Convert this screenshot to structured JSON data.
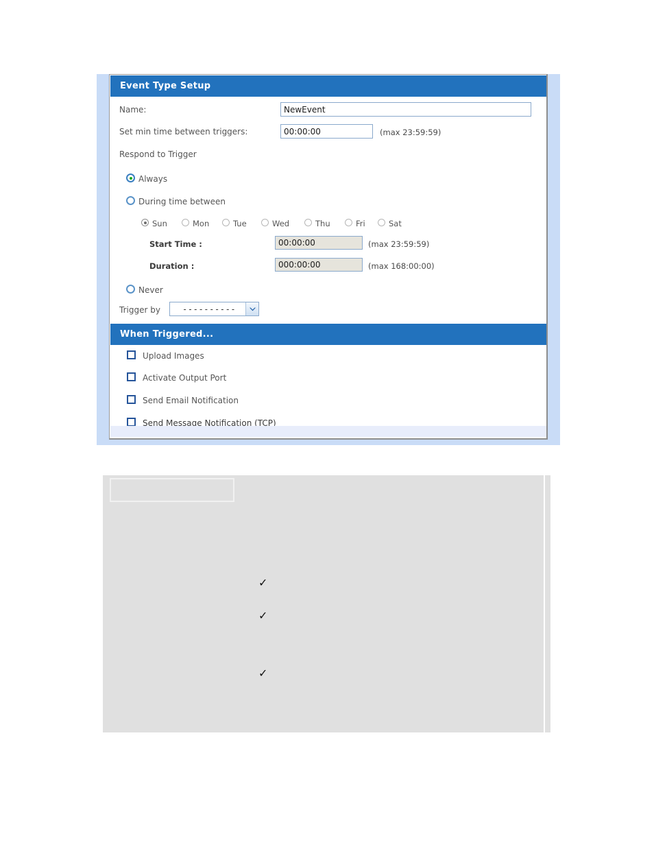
{
  "panel": {
    "sections": [
      {
        "id": "event-type-setup",
        "title": "Event Type Setup"
      },
      {
        "id": "when-triggered",
        "title": "When Triggered..."
      }
    ],
    "fields": {
      "name_label": "Name:",
      "name_value": "NewEvent",
      "name_placeholder": "",
      "min_time_label": "Set min time between triggers:",
      "min_time_value": "00:00:00",
      "min_time_hint": "(max 23:59:59)",
      "respond_label": "Respond to Trigger",
      "start_time_label": "Start Time :",
      "start_time_value": "00:00:00",
      "start_time_hint": "(max 23:59:59)",
      "duration_label": "Duration :",
      "duration_value": "000:00:00",
      "duration_hint": "(max 168:00:00)",
      "trigger_by_label": "Trigger by",
      "trigger_by_value": "----------"
    },
    "respond_options": [
      {
        "id": "always",
        "label": "Always",
        "selected": true
      },
      {
        "id": "during-time-between",
        "label": "During time between",
        "selected": false
      },
      {
        "id": "never",
        "label": "Never",
        "selected": false
      }
    ],
    "days": [
      {
        "id": "sun",
        "label": "Sun",
        "selected": true
      },
      {
        "id": "mon",
        "label": "Mon",
        "selected": false
      },
      {
        "id": "tue",
        "label": "Tue",
        "selected": false
      },
      {
        "id": "wed",
        "label": "Wed",
        "selected": false
      },
      {
        "id": "thu",
        "label": "Thu",
        "selected": false
      },
      {
        "id": "fri",
        "label": "Fri",
        "selected": false
      },
      {
        "id": "sat",
        "label": "Sat",
        "selected": false
      }
    ],
    "actions": [
      {
        "id": "upload-images",
        "label": "Upload Images",
        "checked": false
      },
      {
        "id": "activate-output-port",
        "label": "Activate Output Port",
        "checked": false
      },
      {
        "id": "send-email-notification",
        "label": "Send Email Notification",
        "checked": false
      },
      {
        "id": "send-message-notification-tcp",
        "label": "Send Message Notification (TCP)",
        "checked": false
      }
    ]
  },
  "lower_table": {
    "header_cell_text": "",
    "check_marks": [
      {
        "id": "check-1",
        "glyph": "✓"
      },
      {
        "id": "check-2",
        "glyph": "✓"
      },
      {
        "id": "check-3",
        "glyph": "✓"
      }
    ]
  },
  "colors": {
    "section_header_bg": "#2272bd",
    "panel_frame": "#c9dcf7",
    "input_border": "#8aa9cc",
    "input_disabled_bg": "#e6e4dc",
    "radio_selected_dot": "#1faa1f",
    "checkbox_border": "#25549a",
    "table_bg": "#e0e0e0"
  }
}
